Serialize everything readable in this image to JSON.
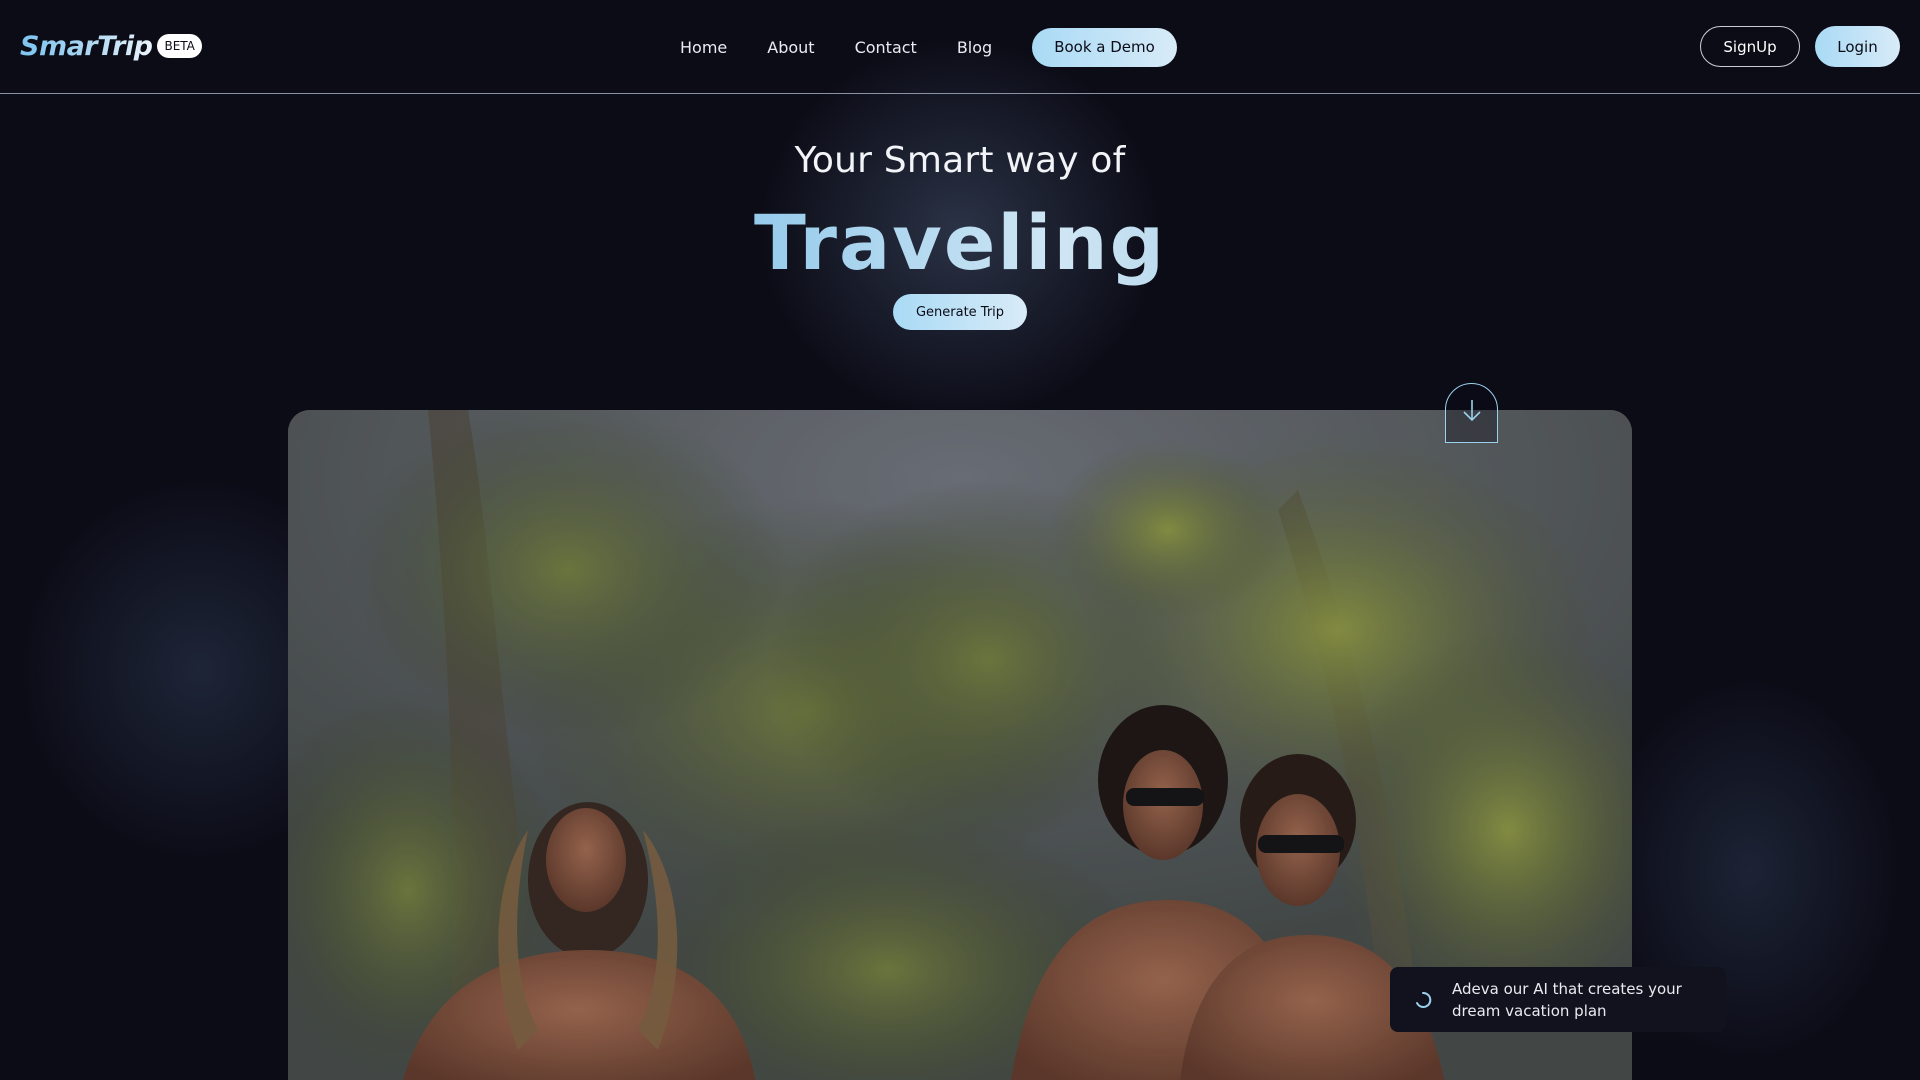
{
  "brand": {
    "name": "SmarTrip",
    "badge": "BETA"
  },
  "nav": {
    "items": [
      {
        "label": "Home"
      },
      {
        "label": "About"
      },
      {
        "label": "Contact"
      },
      {
        "label": "Blog"
      }
    ],
    "demo_label": "Book a Demo"
  },
  "auth": {
    "signup_label": "SignUp",
    "login_label": "Login"
  },
  "hero": {
    "subtitle": "Your Smart way of",
    "title": "Traveling",
    "cta_label": "Generate Trip"
  },
  "icons": {
    "scroll": "arrow-down-icon",
    "loading": "spinner-icon"
  },
  "ai_toast": {
    "text": "Adeva our AI that creates your dream vacation plan"
  },
  "colors": {
    "background": "#0c0c17",
    "accent": "#a9daf5",
    "accent_light": "#d8ebf8",
    "text": "#ffffff",
    "border": "#8a93a4"
  }
}
